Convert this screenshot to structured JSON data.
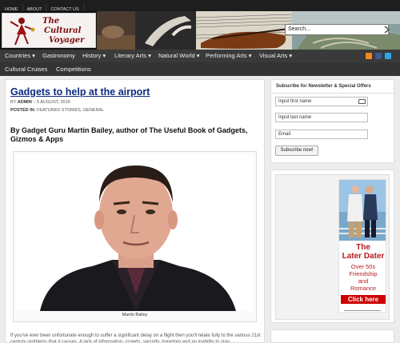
{
  "top_links": [
    "HOME",
    "ABOUT",
    "CONTACT US"
  ],
  "logo": {
    "line1": "The",
    "line2": "Cultural",
    "line3": "Voyager"
  },
  "search": {
    "placeholder": "Search..."
  },
  "main_nav": [
    "Countries ▾",
    "Gastronomy",
    "History ▾",
    "Literary Arts ▾",
    "Natural World ▾",
    "Performing Arts ▾",
    "Visual Arts ▾"
  ],
  "sub_nav": [
    "Cultural Cruises",
    "Competitions"
  ],
  "social_icons": [
    "rss-icon",
    "facebook-icon",
    "twitter-icon"
  ],
  "post": {
    "title": "Gadgets to help at the airport",
    "by_label": "BY",
    "author": "ADMIN",
    "date": "– 5 AUGUST, 2016",
    "posted_label": "POSTED IN:",
    "categories": "FEATURED STORIES, GENERAL",
    "subtitle": "By Gadget Guru Martin Bailey, author of The Useful Book of Gadgets, Gizmos & Apps",
    "photo_caption": "Martin Bailey",
    "body": "If you've ever been unfortunate enough to suffer a significant delay on a flight then you'll relate fully to the various 21st century problems that it causes. A lack of information, crowds, security, boredom and an inability to stay..."
  },
  "newsletter": {
    "title": "Subscribe for Newsletter & Special Offers",
    "first_name": "Input first name",
    "last_name": "Input last name",
    "email": "Email",
    "button": "Subscribe now!"
  },
  "ad": {
    "line1": "The",
    "line2": "Later Dater",
    "line3a": "Over 50s",
    "line3b": "Friendship",
    "line3c": "and",
    "line3d": "Romance",
    "button": "Click here"
  }
}
